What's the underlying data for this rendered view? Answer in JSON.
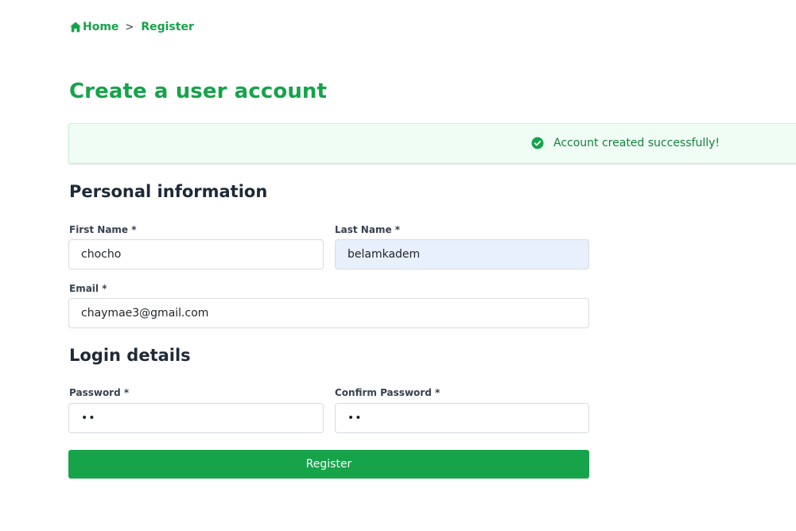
{
  "breadcrumb": {
    "home_label": "Home",
    "separator": ">",
    "current_label": "Register"
  },
  "page_title": "Create a user account",
  "alert": {
    "message": "Account created successfully!",
    "type": "success"
  },
  "personal_section": {
    "title": "Personal information",
    "first_name": {
      "label": "First Name *",
      "value": "chocho"
    },
    "last_name": {
      "label": "Last Name *",
      "value": "belamkadem"
    },
    "email": {
      "label": "Email *",
      "value": "chaymae3@gmail.com"
    }
  },
  "login_section": {
    "title": "Login details",
    "password": {
      "label": "Password *",
      "value": "••"
    },
    "confirm_password": {
      "label": "Confirm Password *",
      "value": "••"
    }
  },
  "register_button_label": "Register",
  "colors": {
    "accent": "#16a34a",
    "alert_bg": "#f0fdf4",
    "autofill_bg": "#e8f0fe"
  },
  "icons": {
    "home": "home-icon",
    "success": "check-circle-icon"
  }
}
